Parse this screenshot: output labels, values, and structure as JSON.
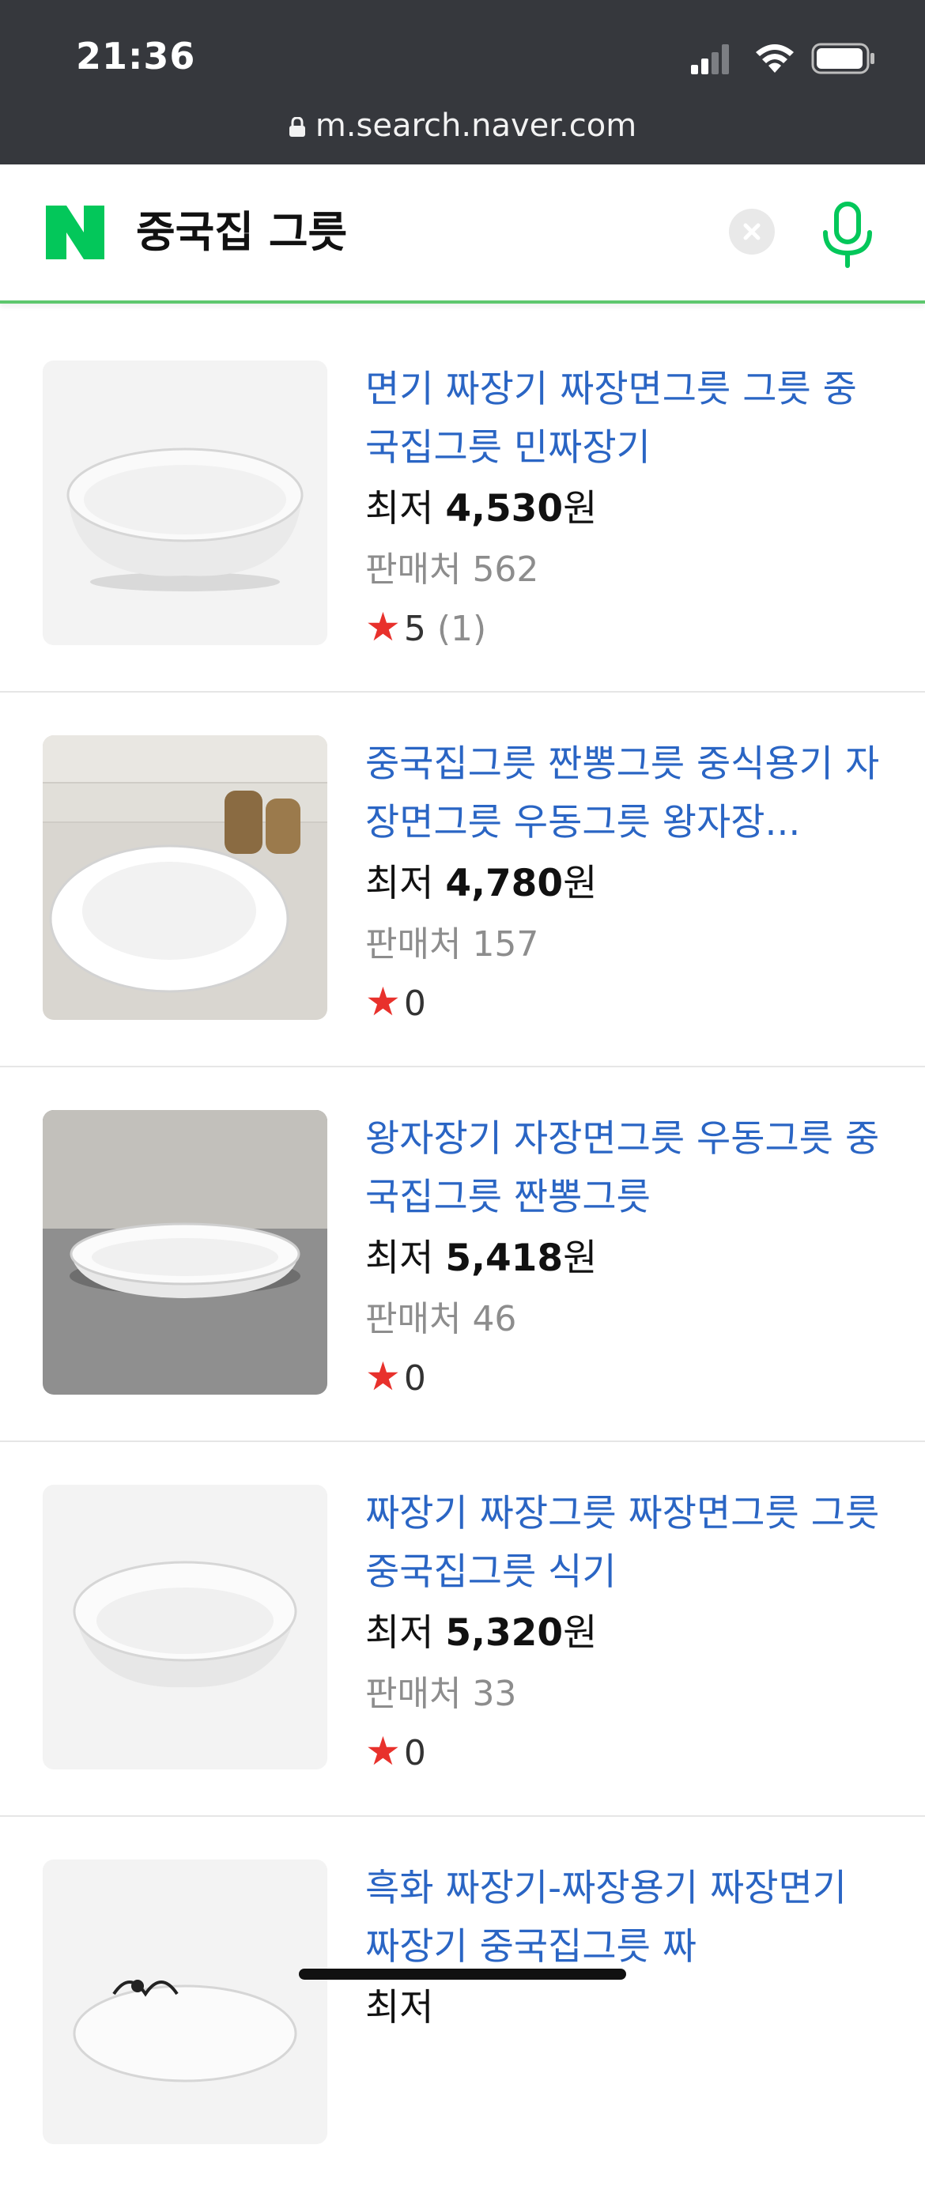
{
  "status_bar": {
    "time": "21:36",
    "url": "m.search.naver.com"
  },
  "search": {
    "logo": "N",
    "query": "중국집 그릇"
  },
  "products": [
    {
      "title": "면기 짜장기 짜장면그릇 그릇 중국집그릇 민짜장기",
      "price_prefix": "최저 ",
      "price": "4,530",
      "price_unit": "원",
      "sellers_label": "판매처 ",
      "sellers": "562",
      "rating": "5",
      "rating_count": "(1)"
    },
    {
      "title": "중국집그릇 짠뽕그릇 중식용기 자장면그릇 우동그릇 왕자장...",
      "price_prefix": "최저 ",
      "price": "4,780",
      "price_unit": "원",
      "sellers_label": "판매처 ",
      "sellers": "157",
      "rating": "0",
      "rating_count": ""
    },
    {
      "title": "왕자장기 자장면그릇 우동그릇 중국집그릇 짠뽕그릇",
      "price_prefix": "최저 ",
      "price": "5,418",
      "price_unit": "원",
      "sellers_label": "판매처 ",
      "sellers": "46",
      "rating": "0",
      "rating_count": ""
    },
    {
      "title": "짜장기 짜장그릇 짜장면그릇 그릇 중국집그릇 식기",
      "price_prefix": "최저 ",
      "price": "5,320",
      "price_unit": "원",
      "sellers_label": "판매처 ",
      "sellers": "33",
      "rating": "0",
      "rating_count": ""
    },
    {
      "title": "흑화 짜장기-짜장용기 짜장면기 짜장기 중국집그릇 짜",
      "price_prefix": "최저 ",
      "price": "",
      "price_unit": "",
      "sellers_label": "",
      "sellers": "",
      "rating": "",
      "rating_count": ""
    }
  ],
  "colors": {
    "status_bar_bg": "#36383d",
    "naver_green": "#03c75a",
    "link_blue": "#2a65c4",
    "star_red": "#e8312c",
    "muted_gray": "#8d8d8d"
  }
}
